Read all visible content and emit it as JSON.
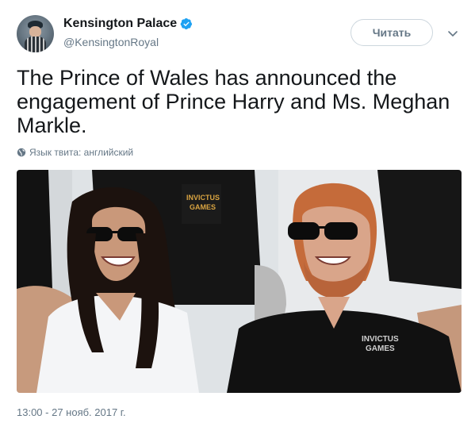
{
  "account": {
    "display_name": "Kensington Palace",
    "handle": "@KensingtonRoyal",
    "verified": true
  },
  "follow_button": {
    "label": "Читать"
  },
  "tweet": {
    "text": "The Prince of Wales has announced the engagement of Prince Harry and Ms. Meghan Markle.",
    "language_note": "Язык твита: английский",
    "timestamp": "13:00 - 27 нояб. 2017 г."
  },
  "photo": {
    "logo_text": "INVICTUS GAMES"
  },
  "colors": {
    "text_primary": "#14171a",
    "text_secondary": "#657786",
    "border": "#ccd6dd",
    "verified_blue": "#1da1f2"
  },
  "icons": {
    "verified": "verified-badge-icon",
    "caret": "chevron-down-icon",
    "language": "globe-icon"
  }
}
